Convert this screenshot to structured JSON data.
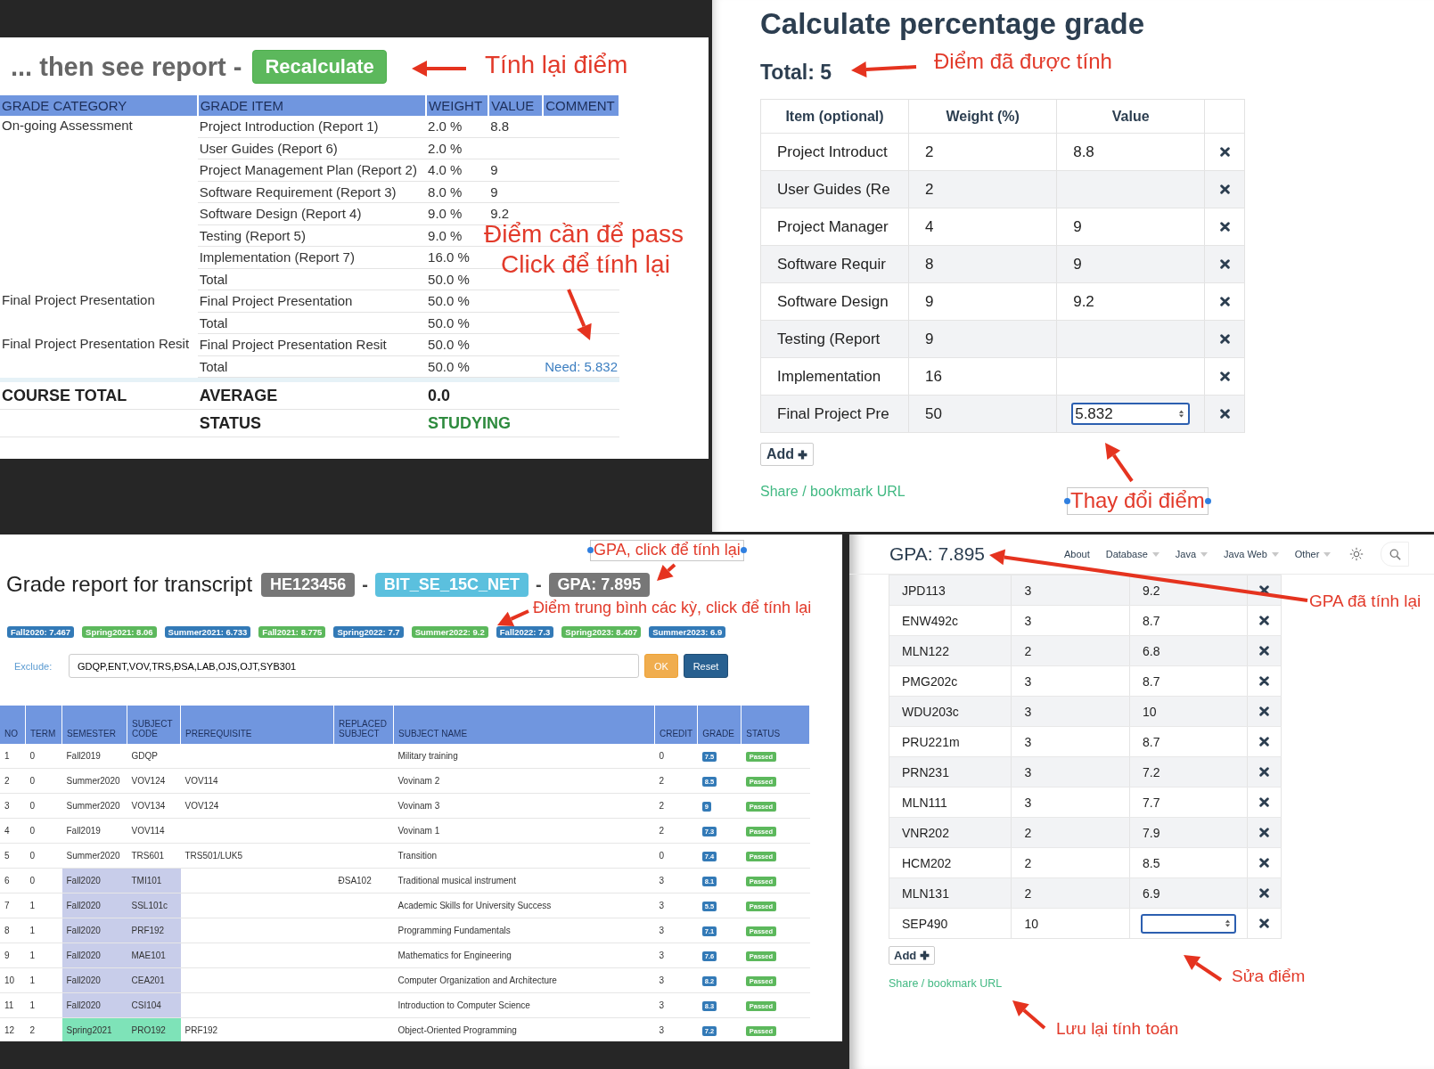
{
  "report": {
    "heading": "... then see report -",
    "recalculate_button": "Recalculate",
    "columns": [
      "GRADE CATEGORY",
      "GRADE ITEM",
      "WEIGHT",
      "VALUE",
      "COMMENT"
    ],
    "rows": [
      {
        "category": "On-going Assessment",
        "item": "Project Introduction (Report 1)",
        "weight": "2.0 %",
        "value": "8.8"
      },
      {
        "item": "User Guides (Report 6)",
        "weight": "2.0 %"
      },
      {
        "item": "Project Management Plan (Report 2)",
        "weight": "4.0 %",
        "value": "9"
      },
      {
        "item": "Software Requirement (Report 3)",
        "weight": "8.0 %",
        "value": "9"
      },
      {
        "item": "Software Design (Report 4)",
        "weight": "9.0 %",
        "value": "9.2"
      },
      {
        "item": "Testing (Report 5)",
        "weight": "9.0 %"
      },
      {
        "item": "Implementation (Report 7)",
        "weight": "16.0 %"
      },
      {
        "item": "Total",
        "weight": "50.0 %"
      },
      {
        "category": "Final Project Presentation",
        "item": "Final Project Presentation",
        "weight": "50.0 %"
      },
      {
        "item": "Total",
        "weight": "50.0 %"
      },
      {
        "category": "Final Project Presentation Resit",
        "item": "Final Project Presentation Resit",
        "weight": "50.0 %"
      },
      {
        "item": "Total",
        "weight": "50.0 %",
        "comment": "Need: 5.832"
      }
    ],
    "course_total": {
      "label": "COURSE TOTAL",
      "average_label": "AVERAGE",
      "average": "0.0",
      "status_label": "STATUS",
      "status": "STUDYING"
    }
  },
  "calculator": {
    "title": "Calculate percentage grade",
    "total": "Total: 5",
    "columns": [
      "Item (optional)",
      "Weight (%)",
      "Value"
    ],
    "rows": [
      {
        "item": "Project Introduct",
        "weight": "2",
        "value": "8.8",
        "editing": false
      },
      {
        "item": "User Guides (Re",
        "weight": "2",
        "editing": false
      },
      {
        "item": "Project Manager",
        "weight": "4",
        "value": "9",
        "editing": false
      },
      {
        "item": "Software Requir",
        "weight": "8",
        "value": "9",
        "editing": false
      },
      {
        "item": "Software Design",
        "weight": "9",
        "value": "9.2",
        "editing": false
      },
      {
        "item": "Testing (Report",
        "weight": "9",
        "editing": false
      },
      {
        "item": "Implementation",
        "weight": "16",
        "editing": false
      },
      {
        "item": "Final Project Pre",
        "weight": "50",
        "value": "5.832",
        "editing": true
      }
    ],
    "add_button": "Add",
    "share_link": "Share / bookmark URL"
  },
  "transcript": {
    "title": "Grade report for transcript",
    "title_badges": [
      {
        "kind": "badge",
        "text": "HE123456",
        "color": "#777777"
      },
      {
        "kind": "separator",
        "text": "-"
      },
      {
        "kind": "badge",
        "text": "BIT_SE_15C_NET",
        "color": "#5bc0de"
      },
      {
        "kind": "separator",
        "text": "-"
      },
      {
        "kind": "badge",
        "text": "GPA: 7.895",
        "color": "#777777"
      }
    ],
    "semesters": [
      {
        "text": "Fall2020: 7.467",
        "color": "#337ab7"
      },
      {
        "text": "Spring2021: 8.06",
        "color": "#5cb85c"
      },
      {
        "text": "Summer2021: 6.733",
        "color": "#337ab7"
      },
      {
        "text": "Fall2021: 8.775",
        "color": "#5cb85c"
      },
      {
        "text": "Spring2022: 7.7",
        "color": "#337ab7"
      },
      {
        "text": "Summer2022: 9.2",
        "color": "#5cb85c"
      },
      {
        "text": "Fall2022: 7.3",
        "color": "#337ab7"
      },
      {
        "text": "Spring2023: 8.407",
        "color": "#5cb85c"
      },
      {
        "text": "Summer2023: 6.9",
        "color": "#337ab7"
      }
    ],
    "exclude_label": "Exclude:",
    "exclude_value": "GDQP,ENT,VOV,TRS,ĐSA,LAB,OJS,OJT,SYB301",
    "ok_button": "OK",
    "reset_button": "Reset",
    "columns": [
      "NO",
      "TERM",
      "SEMESTER",
      "SUBJECT CODE",
      "PREREQUISITE",
      "REPLACED SUBJECT",
      "SUBJECT NAME",
      "CREDIT",
      "GRADE",
      "STATUS"
    ],
    "rows": [
      {
        "no": "1",
        "term": "0",
        "semester": "Fall2019",
        "code": "GDQP",
        "name": "Military training",
        "credit": "0",
        "grade": "7.5",
        "status": "Passed"
      },
      {
        "no": "2",
        "term": "0",
        "semester": "Summer2020",
        "code": "VOV124",
        "prerequisite": "VOV114",
        "name": "Vovinam 2",
        "credit": "2",
        "grade": "8.5",
        "status": "Passed"
      },
      {
        "no": "3",
        "term": "0",
        "semester": "Summer2020",
        "code": "VOV134",
        "prerequisite": "VOV124",
        "name": "Vovinam 3",
        "credit": "2",
        "grade": "9",
        "status": "Passed"
      },
      {
        "no": "4",
        "term": "0",
        "semester": "Fall2019",
        "code": "VOV114",
        "name": "Vovinam 1",
        "credit": "2",
        "grade": "7.3",
        "status": "Passed"
      },
      {
        "no": "5",
        "term": "0",
        "semester": "Summer2020",
        "code": "TRS601",
        "prerequisite": "TRS501/LUK5",
        "name": "Transition",
        "credit": "0",
        "grade": "7.4",
        "status": "Passed"
      },
      {
        "no": "6",
        "term": "0",
        "semester": "Fall2020",
        "code": "TMI101",
        "replaced": "ĐSA102",
        "name": "Traditional musical instrument",
        "credit": "3",
        "grade": "8.1",
        "status": "Passed",
        "color": "#c8cdea"
      },
      {
        "no": "7",
        "term": "1",
        "semester": "Fall2020",
        "code": "SSL101c",
        "name": "Academic Skills for University Success",
        "credit": "3",
        "grade": "5.5",
        "status": "Passed",
        "color": "#c8cdea"
      },
      {
        "no": "8",
        "term": "1",
        "semester": "Fall2020",
        "code": "PRF192",
        "name": "Programming Fundamentals",
        "credit": "3",
        "grade": "7.1",
        "status": "Passed",
        "color": "#c8cdea"
      },
      {
        "no": "9",
        "term": "1",
        "semester": "Fall2020",
        "code": "MAE101",
        "name": "Mathematics for Engineering",
        "credit": "3",
        "grade": "7.6",
        "status": "Passed",
        "color": "#c8cdea"
      },
      {
        "no": "10",
        "term": "1",
        "semester": "Fall2020",
        "code": "CEA201",
        "name": "Computer Organization and Architecture",
        "credit": "3",
        "grade": "8.2",
        "status": "Passed",
        "color": "#c8cdea"
      },
      {
        "no": "11",
        "term": "1",
        "semester": "Fall2020",
        "code": "CSI104",
        "name": "Introduction to Computer Science",
        "credit": "3",
        "grade": "8.3",
        "status": "Passed",
        "color": "#c8cdea"
      },
      {
        "no": "12",
        "term": "2",
        "semester": "Spring2021",
        "code": "PRO192",
        "prerequisite": "PRF192",
        "name": "Object-Oriented Programming",
        "credit": "3",
        "grade": "7.2",
        "status": "Passed",
        "color": "#7ee3b8"
      }
    ]
  },
  "gpa_calculator": {
    "gpa": "GPA: 7.895",
    "nav": [
      {
        "label": "About",
        "dropdown": false
      },
      {
        "label": "Database",
        "dropdown": true
      },
      {
        "label": "Java",
        "dropdown": true
      },
      {
        "label": "Java Web",
        "dropdown": true
      },
      {
        "label": "Other",
        "dropdown": true
      }
    ],
    "rows": [
      {
        "code": "JPD113",
        "credit": "3",
        "value": "9.2",
        "editing": false
      },
      {
        "code": "ENW492c",
        "credit": "3",
        "value": "8.7",
        "editing": false
      },
      {
        "code": "MLN122",
        "credit": "2",
        "value": "6.8",
        "editing": false
      },
      {
        "code": "PMG202c",
        "credit": "3",
        "value": "8.7",
        "editing": false
      },
      {
        "code": "WDU203c",
        "credit": "3",
        "value": "10",
        "editing": false
      },
      {
        "code": "PRU221m",
        "credit": "3",
        "value": "8.7",
        "editing": false
      },
      {
        "code": "PRN231",
        "credit": "3",
        "value": "7.2",
        "editing": false
      },
      {
        "code": "MLN111",
        "credit": "3",
        "value": "7.7",
        "editing": false
      },
      {
        "code": "VNR202",
        "credit": "2",
        "value": "7.9",
        "editing": false
      },
      {
        "code": "HCM202",
        "credit": "2",
        "value": "8.5",
        "editing": false
      },
      {
        "code": "MLN131",
        "credit": "2",
        "value": "6.9",
        "editing": false
      },
      {
        "code": "SEP490",
        "credit": "10",
        "editing": true
      }
    ],
    "add_button": "Add",
    "share_link": "Share / bookmark URL"
  },
  "annotations": [
    {
      "text": "Tính lại điểm",
      "selected": false
    },
    {
      "text": "Điểm cần để pass",
      "selected": false
    },
    {
      "text": "Click để tính lại",
      "selected": false
    },
    {
      "text": "Điểm đã được tính",
      "selected": false
    },
    {
      "text": "Thay đổi điểm",
      "selected": true
    },
    {
      "text": "GPA, click để tính lại",
      "selected": true
    },
    {
      "text": "Điểm trung bình các kỳ, click để tính lại",
      "selected": false
    },
    {
      "text": "GPA đã tính lại",
      "selected": false
    },
    {
      "text": "Sửa điểm",
      "selected": false
    },
    {
      "text": "Lưu lại tính toán",
      "selected": false
    }
  ]
}
